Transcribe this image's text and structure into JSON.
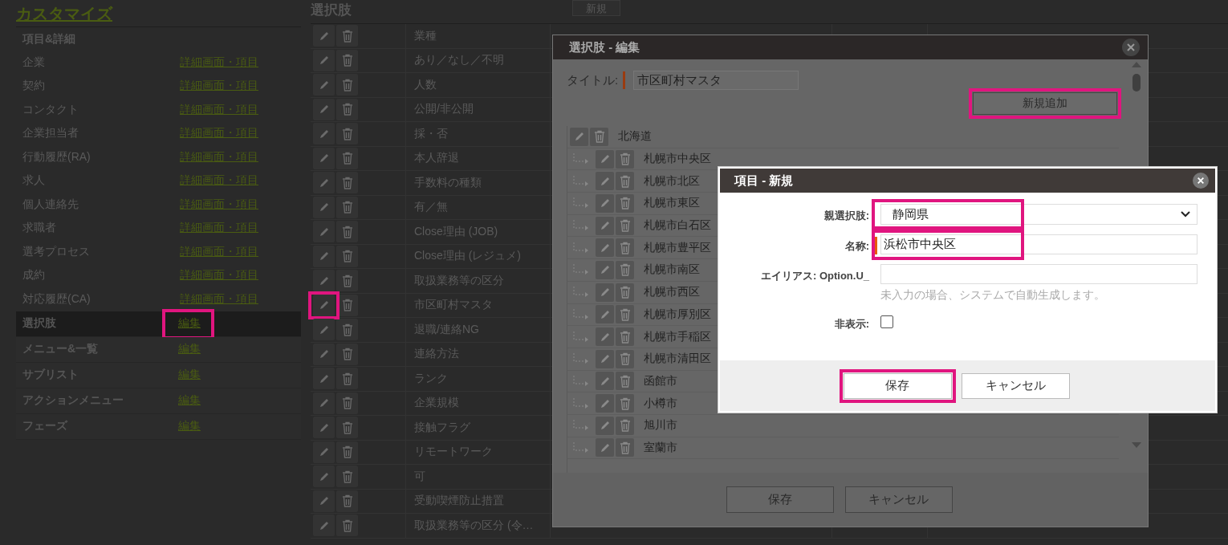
{
  "sidebar": {
    "title": "カスタマイズ",
    "group": {
      "label": "項目&詳細",
      "items": [
        {
          "label": "企業",
          "link": "詳細画面・項目"
        },
        {
          "label": "契約",
          "link": "詳細画面・項目"
        },
        {
          "label": "コンタクト",
          "link": "詳細画面・項目"
        },
        {
          "label": "企業担当者",
          "link": "詳細画面・項目"
        },
        {
          "label": "行動履歴(RA)",
          "link": "詳細画面・項目"
        },
        {
          "label": "求人",
          "link": "詳細画面・項目"
        },
        {
          "label": "個人連絡先",
          "link": "詳細画面・項目"
        },
        {
          "label": "求職者",
          "link": "詳細画面・項目"
        },
        {
          "label": "選考プロセス",
          "link": "詳細画面・項目"
        },
        {
          "label": "成約",
          "link": "詳細画面・項目"
        },
        {
          "label": "対応履歴(CA)",
          "link": "詳細画面・項目"
        }
      ]
    },
    "sections": [
      {
        "label": "選択肢",
        "link": "編集",
        "selected": true,
        "highlighted": true
      },
      {
        "label": "メニュー&一覧",
        "link": "編集",
        "selected": false,
        "highlighted": false
      },
      {
        "label": "サブリスト",
        "link": "編集",
        "selected": false,
        "highlighted": false
      },
      {
        "label": "アクションメニュー",
        "link": "編集",
        "selected": false,
        "highlighted": false
      },
      {
        "label": "フェーズ",
        "link": "編集",
        "selected": false,
        "highlighted": false
      }
    ]
  },
  "main": {
    "title": "選択肢",
    "new_button": "新規",
    "rows": [
      {
        "name": "業種",
        "highlighted": false
      },
      {
        "name": "あり／なし／不明",
        "highlighted": false
      },
      {
        "name": "人数",
        "highlighted": false
      },
      {
        "name": "公開/非公開",
        "highlighted": false
      },
      {
        "name": "採・否",
        "highlighted": false
      },
      {
        "name": "本人辞退",
        "highlighted": false
      },
      {
        "name": "手数料の種類",
        "highlighted": false
      },
      {
        "name": "有／無",
        "highlighted": false
      },
      {
        "name": "Close理由 (JOB)",
        "highlighted": false
      },
      {
        "name": "Close理由 (レジュメ)",
        "highlighted": false
      },
      {
        "name": "取扱業務等の区分",
        "highlighted": false
      },
      {
        "name": "市区町村マスタ",
        "highlighted": true
      },
      {
        "name": "退職/連絡NG",
        "highlighted": false
      },
      {
        "name": "連絡方法",
        "highlighted": false
      },
      {
        "name": "ランク",
        "highlighted": false
      },
      {
        "name": "企業規模",
        "highlighted": false
      },
      {
        "name": "接触フラグ",
        "highlighted": false
      },
      {
        "name": "リモートワーク",
        "highlighted": false
      },
      {
        "name": "可",
        "highlighted": false
      },
      {
        "name": "受動喫煙防止措置",
        "highlighted": false
      },
      {
        "name": "取扱業務等の区分 (令…",
        "highlighted": false
      }
    ]
  },
  "edit_dialog": {
    "title": "選択肢 - 編集",
    "title_label": "タイトル:",
    "title_value": "市区町村マスタ",
    "add_button": {
      "label": "新規追加",
      "highlighted": true
    },
    "tree": [
      {
        "label": "北海道",
        "children": [
          {
            "label": "札幌市中央区"
          },
          {
            "label": "札幌市北区"
          },
          {
            "label": "札幌市東区"
          },
          {
            "label": "札幌市白石区"
          },
          {
            "label": "札幌市豊平区"
          },
          {
            "label": "札幌市南区"
          },
          {
            "label": "札幌市西区"
          },
          {
            "label": "札幌市厚別区"
          },
          {
            "label": "札幌市手稲区"
          },
          {
            "label": "札幌市清田区"
          },
          {
            "label": "函館市"
          },
          {
            "label": "小樽市"
          },
          {
            "label": "旭川市"
          },
          {
            "label": "室蘭市"
          }
        ]
      }
    ],
    "buttons": [
      "保存",
      "キャンセル"
    ]
  },
  "new_dialog": {
    "title": "項目 - 新規",
    "fields": [
      {
        "kind": "select",
        "label": "親選択肢:",
        "value": "静岡県",
        "required": false,
        "highlighted": true
      },
      {
        "kind": "text",
        "label": "名称:",
        "value": "浜松市中央区",
        "required": true,
        "highlighted": true
      },
      {
        "kind": "text",
        "label": "エイリアス: Option.U_",
        "hint": "未入力の場合、システムで自動生成します。",
        "required": false,
        "highlighted": false
      },
      {
        "kind": "checkbox",
        "label": "非表示:",
        "checked": false
      }
    ],
    "buttons": [
      {
        "label": "保存",
        "highlighted": true
      },
      {
        "label": "キャンセル",
        "highlighted": false
      }
    ]
  }
}
